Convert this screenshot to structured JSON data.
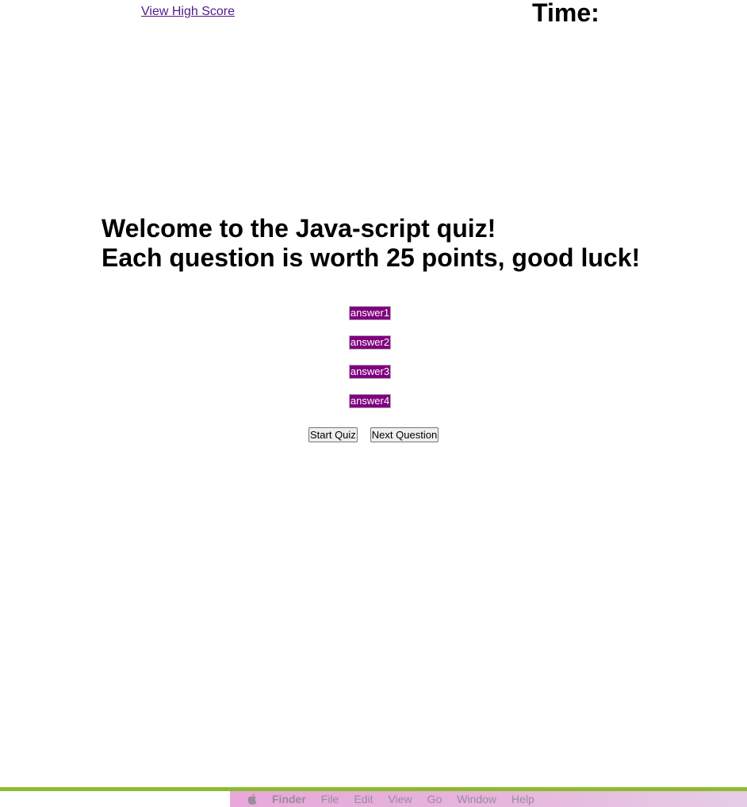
{
  "header": {
    "high_score_link": "View High Score",
    "timer_label": "Time:"
  },
  "quiz": {
    "welcome_line1": "Welcome to the Java-script quiz!",
    "welcome_line2": "Each question is worth 25 points, good luck!",
    "answers": [
      "answer1",
      "answer2",
      "answer3",
      "answer4"
    ],
    "start_button": "Start Quiz",
    "next_button": "Next Question"
  },
  "menubar": {
    "apple_icon": "apple-logo-icon",
    "app_name": "Finder",
    "items": [
      "File",
      "Edit",
      "View",
      "Go",
      "Window",
      "Help"
    ]
  },
  "colors": {
    "answer_bg": "#800080",
    "link": "#551a8b",
    "accent_line": "#8cbc2e"
  }
}
